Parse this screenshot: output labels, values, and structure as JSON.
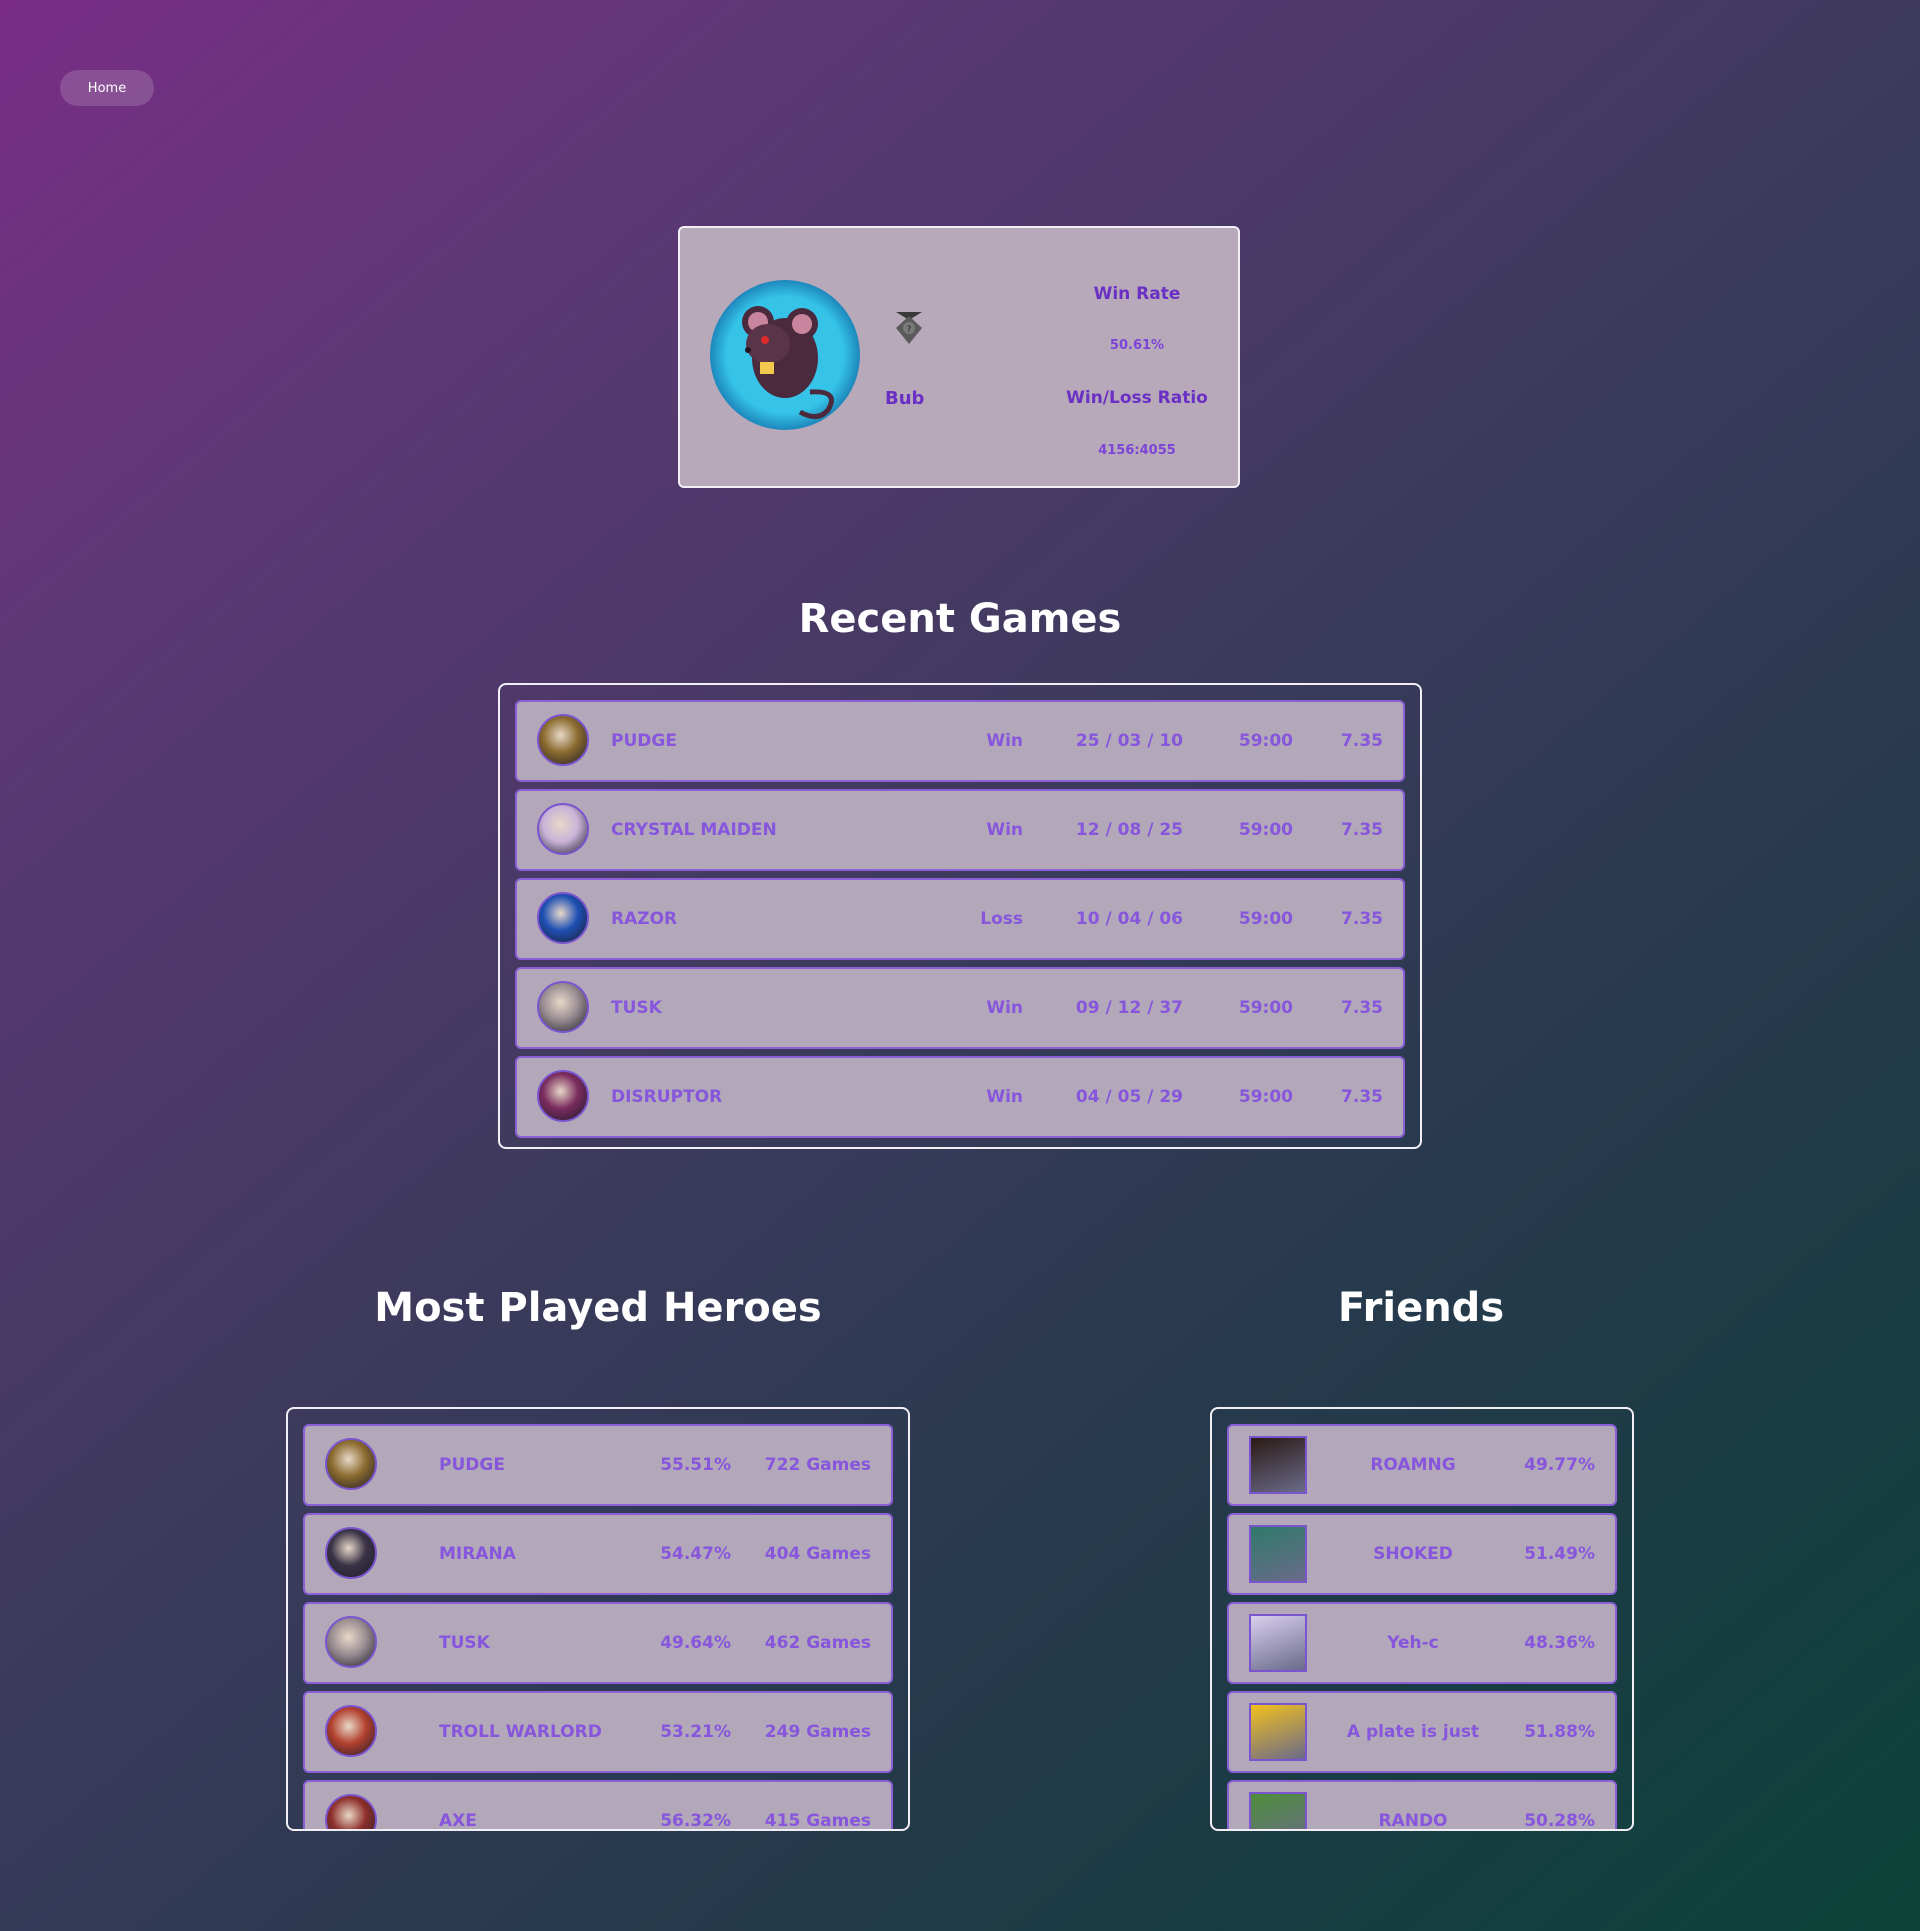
{
  "nav": {
    "home_label": "Home"
  },
  "profile": {
    "name": "Bub",
    "win_rate_label": "Win Rate",
    "win_rate": "50.61%",
    "ratio_label": "Win/Loss Ratio",
    "ratio": "4156:4055",
    "avatar_icon": "rat-avatar-icon",
    "rank_icon": "rank-medal-icon"
  },
  "recent_games": {
    "title": "Recent Games",
    "rows": [
      {
        "hero": "PUDGE",
        "result": "Win",
        "kda": "25 / 03 / 10",
        "duration": "59:00",
        "patch": "7.35",
        "icon_color": "#8a6a2e"
      },
      {
        "hero": "CRYSTAL MAIDEN",
        "result": "Win",
        "kda": "12 / 08 / 25",
        "duration": "59:00",
        "patch": "7.35",
        "icon_color": "#c9b3d8"
      },
      {
        "hero": "RAZOR",
        "result": "Loss",
        "kda": "10 / 04 / 06",
        "duration": "59:00",
        "patch": "7.35",
        "icon_color": "#1e4fb4"
      },
      {
        "hero": "TUSK",
        "result": "Win",
        "kda": "09 / 12 / 37",
        "duration": "59:00",
        "patch": "7.35",
        "icon_color": "#9a8e92"
      },
      {
        "hero": "DISRUPTOR",
        "result": "Win",
        "kda": "04 / 05 / 29",
        "duration": "59:00",
        "patch": "7.35",
        "icon_color": "#7a2b5e"
      }
    ]
  },
  "most_played": {
    "title": "Most Played Heroes",
    "rows": [
      {
        "hero": "PUDGE",
        "win_rate": "55.51%",
        "games": "722 Games",
        "icon_color": "#8a6a2e"
      },
      {
        "hero": "MIRANA",
        "win_rate": "54.47%",
        "games": "404 Games",
        "icon_color": "#3a3346"
      },
      {
        "hero": "TUSK",
        "win_rate": "49.64%",
        "games": "462 Games",
        "icon_color": "#9a8e92"
      },
      {
        "hero": "TROLL WARLORD",
        "win_rate": "53.21%",
        "games": "249 Games",
        "icon_color": "#b2402e"
      },
      {
        "hero": "AXE",
        "win_rate": "56.32%",
        "games": "415 Games",
        "icon_color": "#8e2f2a"
      }
    ]
  },
  "friends": {
    "title": "Friends",
    "rows": [
      {
        "name": "ROAMNG",
        "win_rate": "49.77%",
        "icon_color": "#2a1a14"
      },
      {
        "name": "SHOKED",
        "win_rate": "51.49%",
        "icon_color": "#2f7a6a"
      },
      {
        "name": "Yeh-c",
        "win_rate": "48.36%",
        "icon_color": "#d9cfee"
      },
      {
        "name": "A plate is just",
        "win_rate": "51.88%",
        "icon_color": "#f2c01e"
      },
      {
        "name": "RANDO",
        "win_rate": "50.28%",
        "icon_color": "#4e8f3a"
      }
    ]
  }
}
